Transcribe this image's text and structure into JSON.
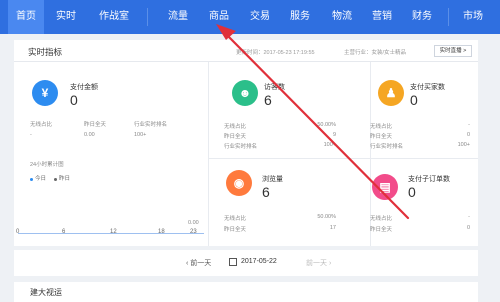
{
  "nav": {
    "items": [
      "首页",
      "实时",
      "作战室",
      "流量",
      "商品",
      "交易",
      "服务",
      "物流",
      "营销",
      "财务",
      "市场"
    ]
  },
  "panel": {
    "title": "实时指标",
    "update_time": "更新时间：2017-05-23 17:19:55",
    "industry": "主营行业：女装/女士精品",
    "live_button": "实时直播 >"
  },
  "metrics": [
    {
      "name": "支付金额",
      "value": "0",
      "icon": "yen-icon",
      "rows": [
        [
          "无线占比",
          "-"
        ],
        [
          "昨日全天",
          "0.00"
        ],
        [
          "行业实时排名",
          "100+"
        ]
      ]
    },
    {
      "name": "访客数",
      "value": "6",
      "icon": "visitor-icon",
      "rows": [
        [
          "无线占比",
          "50.00%"
        ],
        [
          "昨日全天",
          "9"
        ],
        [
          "行业实时排名",
          "100+"
        ]
      ]
    },
    {
      "name": "支付买家数",
      "value": "0",
      "icon": "buyer-icon",
      "rows": [
        [
          "无线占比",
          "-"
        ],
        [
          "昨日全天",
          "0"
        ],
        [
          "行业实时排名",
          "100+"
        ]
      ]
    },
    {
      "name": "浏览量",
      "value": "6",
      "icon": "eye-icon",
      "rows": [
        [
          "无线占比",
          "50.00%"
        ],
        [
          "昨日全天",
          "17"
        ]
      ]
    },
    {
      "name": "支付子订单数",
      "value": "0",
      "icon": "order-icon",
      "rows": [
        [
          "无线占比",
          "-"
        ],
        [
          "昨日全天",
          "0"
        ]
      ]
    }
  ],
  "chart": {
    "title": "24小时累计图",
    "legend_today": "今日",
    "legend_yesterday": "昨日",
    "top_value": "0.00",
    "x_ticks": [
      "0",
      "6",
      "12",
      "18",
      "23"
    ]
  },
  "datebar": {
    "prev": "前一天",
    "date": "2017-05-22",
    "next": "前一天"
  },
  "bottom": {
    "title": "建大视运"
  },
  "colors": {
    "nav": "#2f6fe0",
    "yen": "#2d8cf0",
    "visitor": "#2bbf8a",
    "buyer": "#f5a623",
    "eye": "#ff7a3d",
    "order": "#f24c8a",
    "arrow": "#e0303a"
  }
}
